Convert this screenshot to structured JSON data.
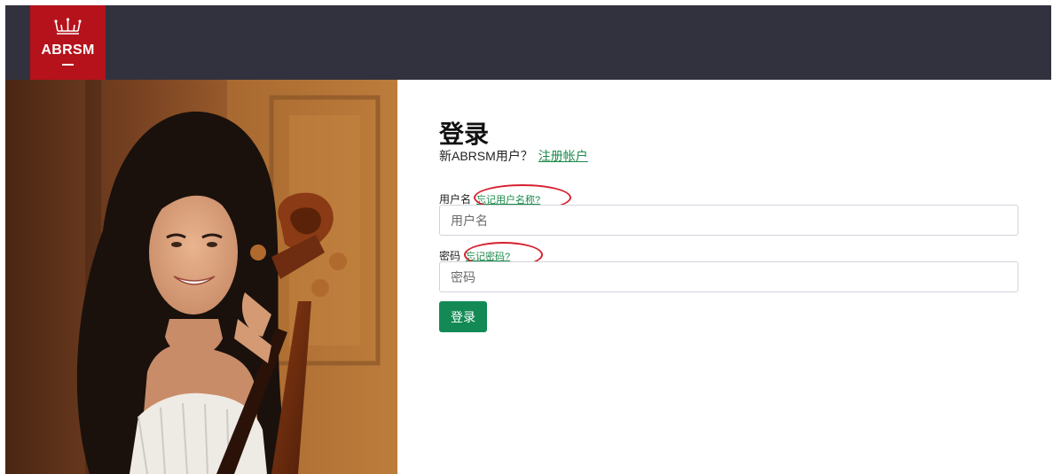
{
  "header": {
    "logo_text": "ABRSM",
    "logo_icon": "crown-icon",
    "background_color": "#32323e",
    "logo_color": "#b5121b"
  },
  "hero": {
    "image": "girl-with-cello-photo"
  },
  "login": {
    "title": "登录",
    "new_user_prompt": "新ABRSM用户？",
    "register_link": "注册帐户",
    "username": {
      "label": "用户名",
      "forgot_link": "忘记用户名称?",
      "placeholder": "用户名"
    },
    "password": {
      "label": "密码",
      "forgot_link": "忘记密码?",
      "placeholder": "密码"
    },
    "submit_label": "登录",
    "accent_color": "#138a55",
    "annotation_color": "#d62030"
  }
}
